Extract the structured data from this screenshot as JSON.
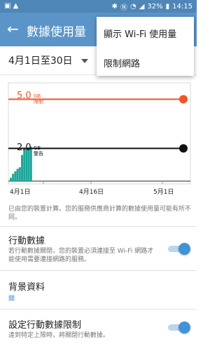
{
  "status_bar": {
    "left_icons": [
      "image-icon",
      "warning-icon"
    ],
    "battery": "32%",
    "time": "14:15"
  },
  "app_bar": {
    "title": "數據使用量"
  },
  "overflow_menu": {
    "items": [
      "顯示 Wi-Fi 使用量",
      "限制網路"
    ]
  },
  "date_range": {
    "label": "4月1日至30日"
  },
  "chart": {
    "limit_value": "5.0",
    "limit_unit": "GB",
    "limit_label": "限制",
    "warning_value": "2.0",
    "warning_unit": "GB",
    "warning_label": "警告",
    "x_labels": [
      "4月1日",
      "4月16日",
      "5月1日"
    ],
    "colors": {
      "limit": "#f2532b",
      "warning": "#111111",
      "usage": "#1ea79a"
    }
  },
  "chart_data": {
    "type": "bar",
    "categories": [
      "4/1",
      "4/2",
      "4/3",
      "4/4",
      "4/5",
      "4/6",
      "4/7",
      "4/8",
      "4/9",
      "4/10"
    ],
    "values": [
      0.2,
      0.45,
      0.6,
      0.75,
      0.85,
      1.6,
      1.95,
      2.0,
      2.05,
      2.1
    ],
    "ylim": [
      0,
      6
    ],
    "x_tick_labels": [
      "4月1日",
      "4月16日",
      "5月1日"
    ],
    "limit": 5.0,
    "warning": 2.0
  },
  "note": "已由您的裝置計算。您的服務供應商計算的數據使用量可能有所不同。",
  "settings": {
    "mobile_data": {
      "title": "行動數據",
      "desc": "若行動數據關閉，您的裝置必須連接至 Wi-Fi 網路才能使用需要連接網路的服務。",
      "enabled": true
    },
    "background_data": {
      "title": "背景資料",
      "value": "開"
    },
    "set_limit": {
      "title": "設定行動數據限制",
      "desc": "達到特定上限時，將關閉行動數據。",
      "enabled": true
    }
  }
}
